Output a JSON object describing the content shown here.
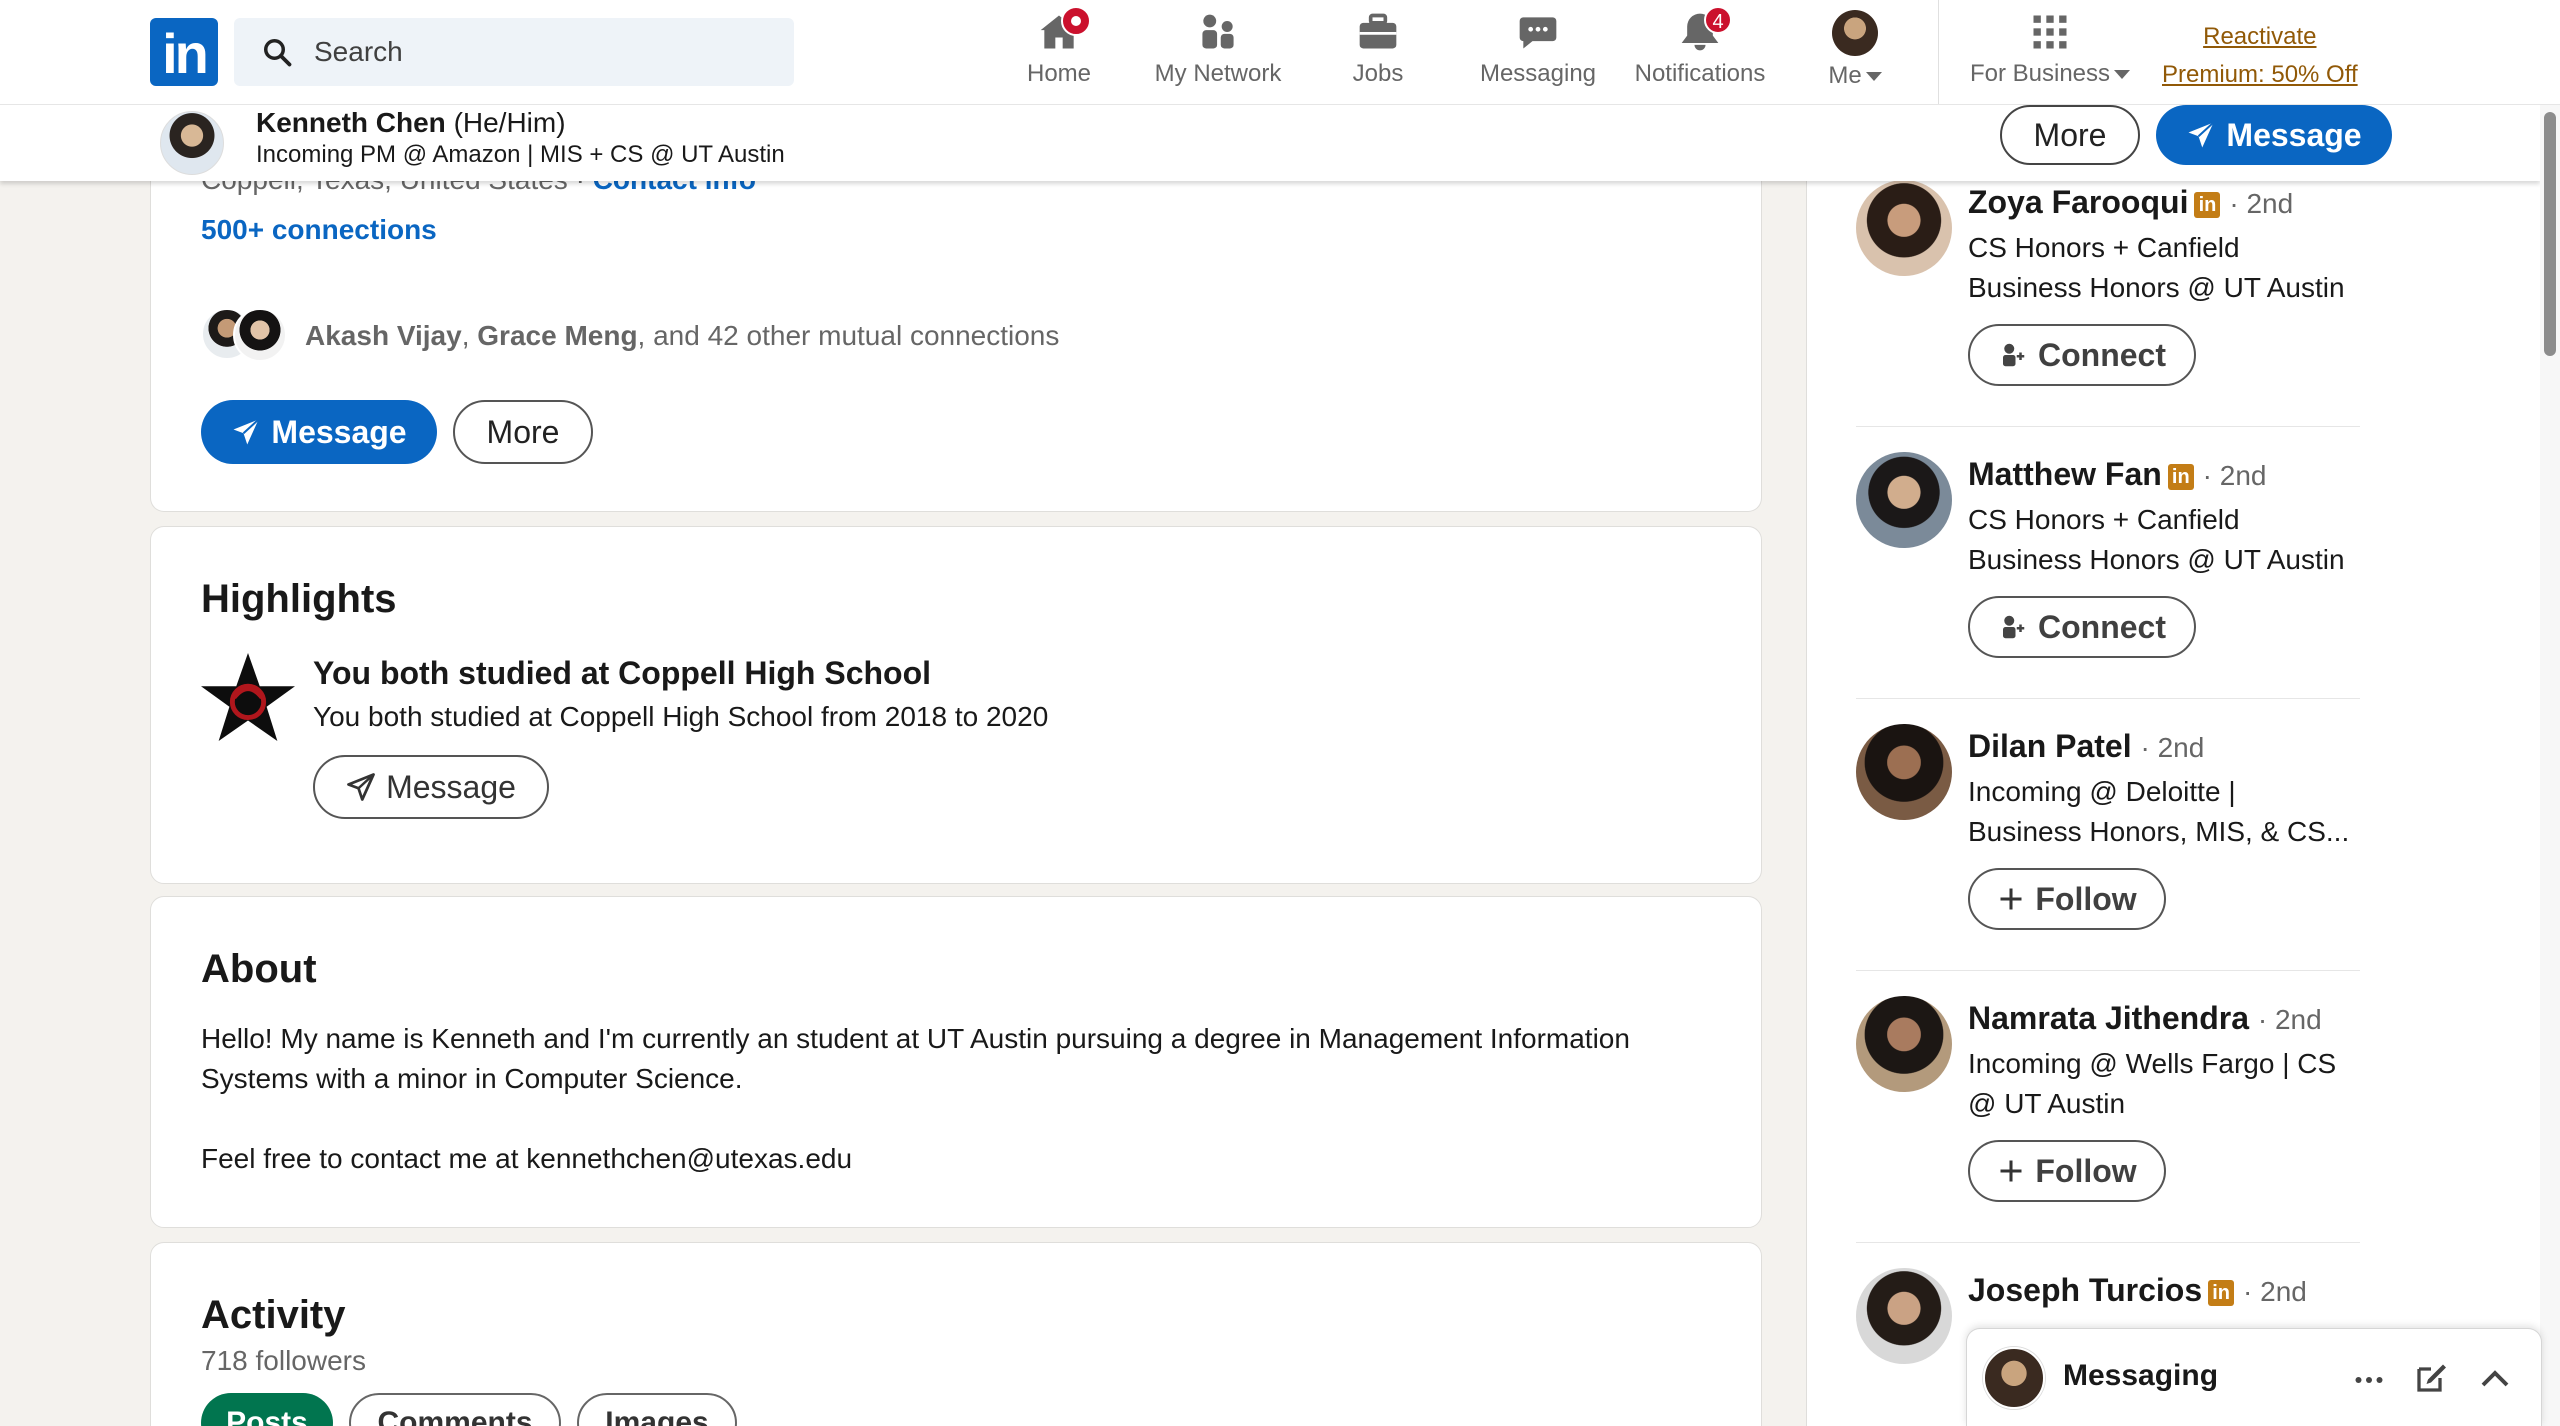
{
  "nav": {
    "search_placeholder": "Search",
    "items": [
      {
        "label": "Home",
        "icon": "home-icon"
      },
      {
        "label": "My Network",
        "icon": "network-icon"
      },
      {
        "label": "Jobs",
        "icon": "briefcase-icon"
      },
      {
        "label": "Messaging",
        "icon": "chat-icon"
      },
      {
        "label": "Notifications",
        "icon": "bell-icon",
        "badge": "4"
      },
      {
        "label": "Me",
        "icon": "avatar"
      },
      {
        "label": "For Business",
        "icon": "grid-icon"
      }
    ],
    "premium_line1": "Reactivate",
    "premium_line2": "Premium: 50% Off"
  },
  "sticky": {
    "name": "Kenneth Chen",
    "pronouns": "(He/Him)",
    "headline": "Incoming PM @ Amazon | MIS + CS @ UT Austin",
    "more": "More",
    "message": "Message"
  },
  "profile": {
    "headline_partial": "Incoming PM @ Amazon | MIS + CS @ UT Austin",
    "location": "Coppell, Texas, United States",
    "separator": "·",
    "contact_info": "Contact info",
    "connections": "500+ connections",
    "mutual_name1": "Akash Vijay",
    "mutual_sep": ",",
    "mutual_name2": "Grace Meng",
    "mutual_rest": ", and 42 other mutual connections",
    "message": "Message",
    "more": "More"
  },
  "highlights": {
    "title": "Highlights",
    "item_title": "You both studied at Coppell High School",
    "item_sub": "You both studied at Coppell High School from 2018 to 2020",
    "message": "Message"
  },
  "about": {
    "title": "About",
    "line1": "Hello! My name is Kenneth and I'm currently an student at UT Austin pursuing a degree in Management Information",
    "line2": "Systems with a minor in Computer Science.",
    "line3": "Feel free to contact me at kennethchen@utexas.edu"
  },
  "activity": {
    "title": "Activity",
    "followers": "718 followers",
    "tabs": [
      "Posts",
      "Comments",
      "Images"
    ]
  },
  "suggestions": [
    {
      "name": "Zoya Farooqui",
      "premium": true,
      "degree": "· 2nd",
      "desc_l1": "CS Honors + Canfield",
      "desc_l2": "Business Honors @ UT Austin",
      "action": "Connect"
    },
    {
      "name": "Matthew Fan",
      "premium": true,
      "degree": "· 2nd",
      "desc_l1": "CS Honors + Canfield",
      "desc_l2": "Business Honors @ UT Austin",
      "action": "Connect"
    },
    {
      "name": "Dilan Patel",
      "premium": false,
      "degree": "· 2nd",
      "desc_l1": "Incoming @ Deloitte |",
      "desc_l2": "Business Honors, MIS, & CS...",
      "action": "Follow"
    },
    {
      "name": "Namrata Jithendra",
      "premium": false,
      "degree": "· 2nd",
      "desc_l1": "Incoming @ Wells Fargo | CS",
      "desc_l2": "@ UT Austin",
      "action": "Follow"
    },
    {
      "name": "Joseph Turcios",
      "premium": true,
      "degree": "· 2nd",
      "desc_l1": "",
      "desc_l2": "",
      "action": ""
    }
  ],
  "messaging_dock": {
    "title": "Messaging"
  },
  "colors": {
    "linkedin_blue": "#0a66c2",
    "premium_gold": "#915907",
    "badge_red": "#cb112d",
    "activity_green": "#01754f"
  }
}
